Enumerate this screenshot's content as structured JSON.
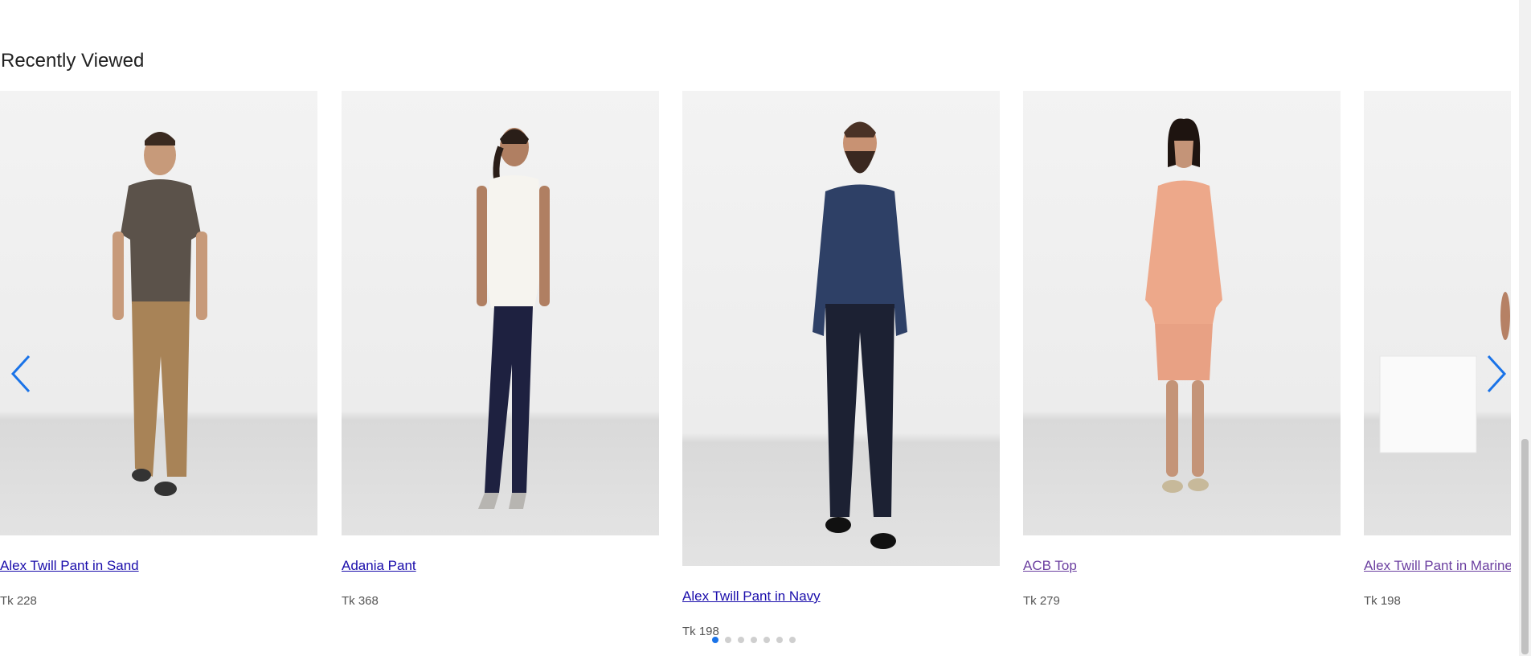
{
  "section": {
    "title": "Recently Viewed"
  },
  "products": [
    {
      "name": "Alex Twill Pant in Sand",
      "price": "Tk 228",
      "icon": "man-in-brown-tshirt-photo"
    },
    {
      "name": "Adania Pant",
      "price": "Tk 368",
      "icon": "woman-in-white-blouse-photo"
    },
    {
      "name": "Alex Twill Pant in Navy",
      "price": "Tk 198",
      "icon": "bearded-man-in-navy-shirt-photo"
    },
    {
      "name": "ACB Top",
      "price": "Tk 279",
      "icon": "woman-in-peach-top-photo"
    },
    {
      "name": "Alex Twill Pant in Marine",
      "price": "Tk 198",
      "icon": "partial-model-photo"
    }
  ],
  "carousel": {
    "prev_icon": "chevron-left-icon",
    "next_icon": "chevron-right-icon",
    "dot_count": 7,
    "active_dot": 1
  },
  "colors": {
    "accent": "#1a73e8",
    "link": "#1a0dab",
    "visited_link": "#6b3fa0"
  }
}
